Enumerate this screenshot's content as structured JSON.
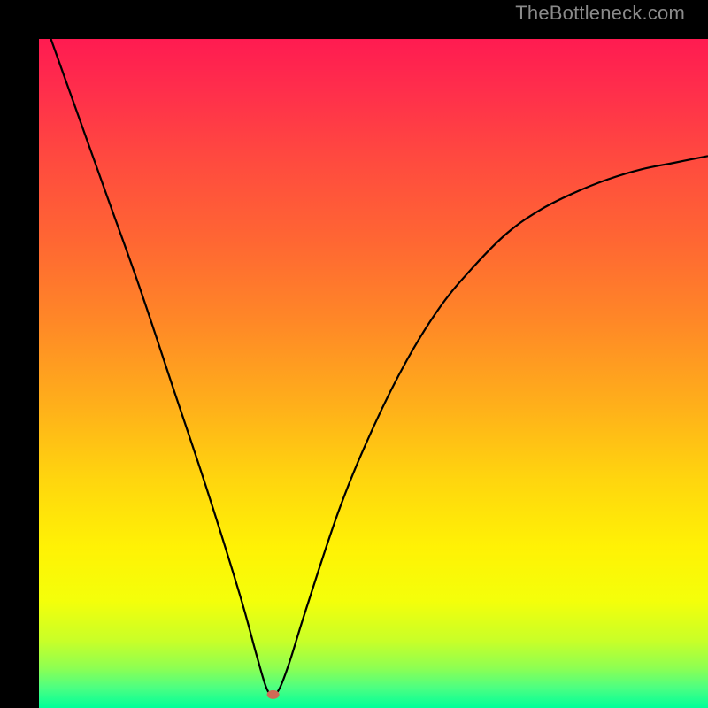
{
  "watermark": "TheBottleneck.com",
  "chart_data": {
    "type": "line",
    "title": "",
    "xlabel": "",
    "ylabel": "",
    "xlim": [
      0,
      100
    ],
    "ylim": [
      0,
      100
    ],
    "grid": false,
    "legend": false,
    "curve": {
      "name": "bottleneck-curve",
      "minimum_x": 35,
      "minimum_y": 2,
      "x": [
        0,
        5,
        10,
        15,
        20,
        25,
        30,
        32.5,
        34,
        35,
        36,
        37.5,
        40,
        45,
        50,
        55,
        60,
        65,
        70,
        75,
        80,
        85,
        90,
        95,
        100
      ],
      "y": [
        105,
        91,
        77,
        63,
        48,
        33,
        17,
        8,
        3,
        2,
        3,
        7,
        15,
        30,
        42,
        52,
        60,
        66,
        71,
        74.5,
        77,
        79,
        80.5,
        81.5,
        82.5
      ]
    },
    "marker": {
      "x": 35,
      "y": 2,
      "color": "#d06a56"
    },
    "gradient_stops": [
      {
        "offset": 0.0,
        "color": "#ff1b51"
      },
      {
        "offset": 0.08,
        "color": "#ff2f4b"
      },
      {
        "offset": 0.18,
        "color": "#ff4a3f"
      },
      {
        "offset": 0.3,
        "color": "#ff6633"
      },
      {
        "offset": 0.42,
        "color": "#ff8727"
      },
      {
        "offset": 0.55,
        "color": "#ffb01a"
      },
      {
        "offset": 0.66,
        "color": "#ffd60e"
      },
      {
        "offset": 0.76,
        "color": "#fff205"
      },
      {
        "offset": 0.84,
        "color": "#f4ff0a"
      },
      {
        "offset": 0.9,
        "color": "#c8ff28"
      },
      {
        "offset": 0.94,
        "color": "#8eff52"
      },
      {
        "offset": 0.97,
        "color": "#4cff82"
      },
      {
        "offset": 1.0,
        "color": "#00ff99"
      }
    ]
  }
}
